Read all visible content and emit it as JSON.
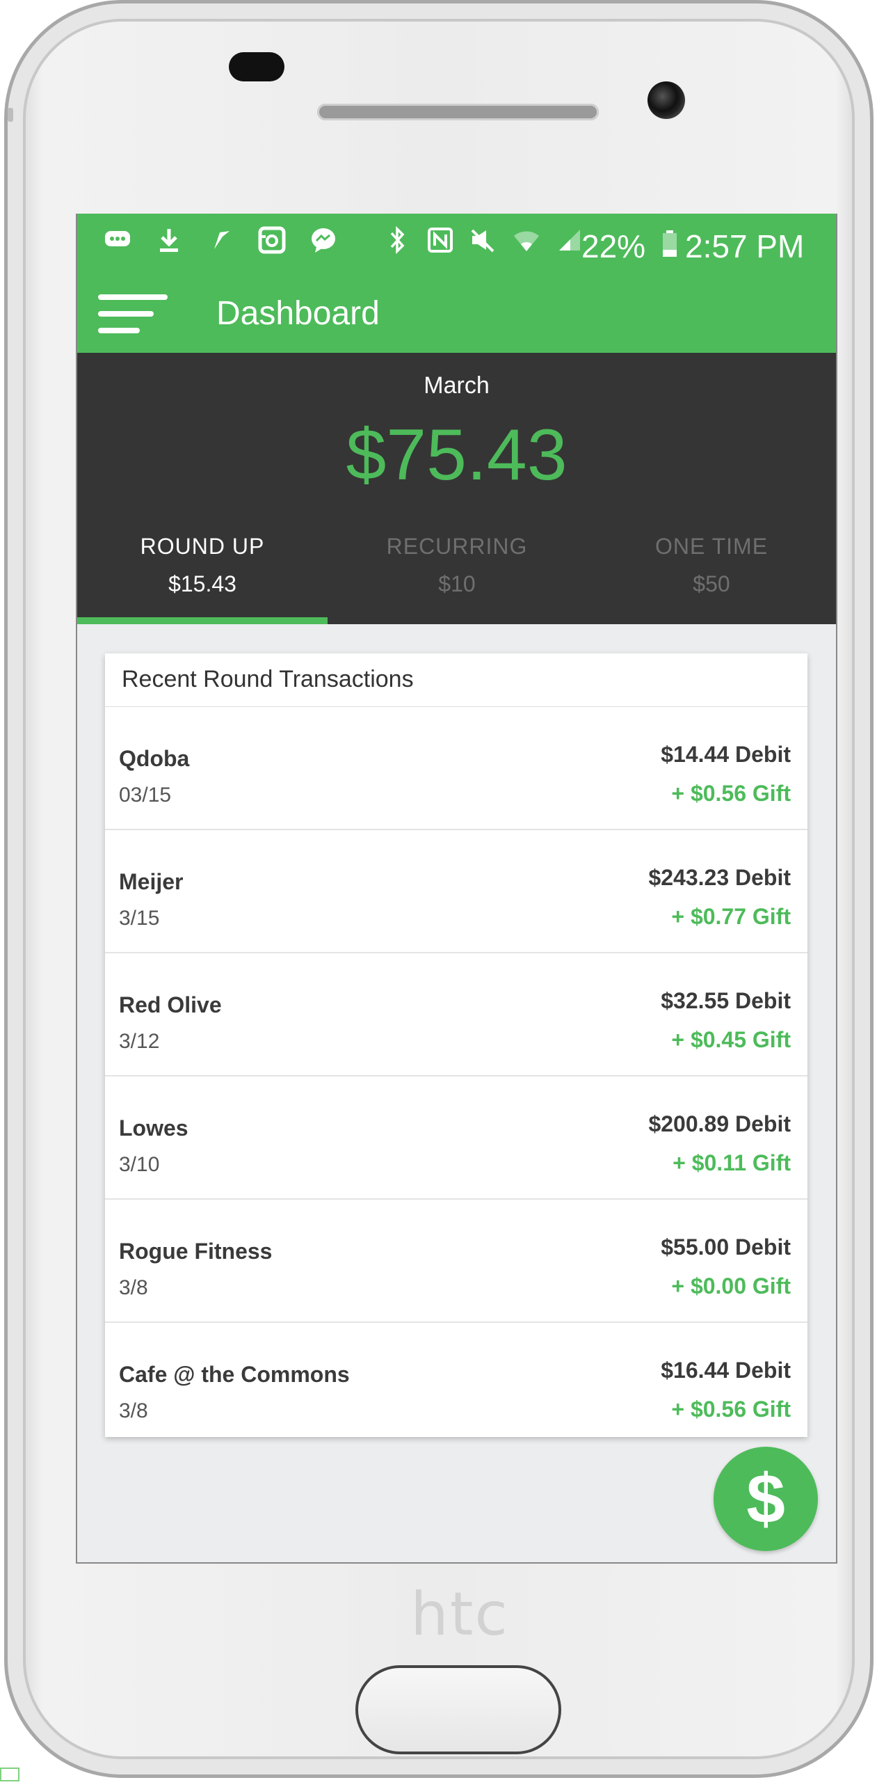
{
  "device": {
    "brand_text": "htc"
  },
  "statusbar": {
    "battery": "22%",
    "time": "2:57 PM",
    "icons_left": [
      "message-icon",
      "download-icon",
      "navigation-icon",
      "instagram-icon",
      "messenger-icon"
    ],
    "icons_right": [
      "bluetooth-icon",
      "nfc-icon",
      "mute-icon",
      "wifi-icon",
      "signal-icon",
      "battery-icon"
    ]
  },
  "appbar": {
    "title": "Dashboard"
  },
  "summary": {
    "month": "March",
    "total": "$75.43",
    "tabs": [
      {
        "label": "ROUND UP",
        "amount": "$15.43",
        "active": true
      },
      {
        "label": "RECURRING",
        "amount": "$10",
        "active": false
      },
      {
        "label": "ONE TIME",
        "amount": "$50",
        "active": false
      }
    ]
  },
  "transactions": {
    "title": "Recent Round Transactions",
    "items": [
      {
        "name": "Qdoba",
        "date": "03/15",
        "debit": "$14.44 Debit",
        "gift": "+ $0.56 Gift"
      },
      {
        "name": "Meijer",
        "date": "3/15",
        "debit": "$243.23 Debit",
        "gift": "+ $0.77 Gift"
      },
      {
        "name": "Red Olive",
        "date": "3/12",
        "debit": "$32.55 Debit",
        "gift": "+ $0.45 Gift"
      },
      {
        "name": "Lowes",
        "date": "3/10",
        "debit": "$200.89 Debit",
        "gift": "+ $0.11 Gift"
      },
      {
        "name": "Rogue Fitness",
        "date": "3/8",
        "debit": "$55.00 Debit",
        "gift": "+ $0.00 Gift"
      },
      {
        "name": "Cafe @ the Commons",
        "date": "3/8",
        "debit": "$16.44 Debit",
        "gift": "+ $0.56 Gift"
      }
    ]
  },
  "fab": {
    "icon": "dollar-icon",
    "symbol": "$"
  },
  "colors": {
    "brand_green": "#4dbb5a",
    "summary_bg": "#353535",
    "screen_bg": "#ecedee"
  }
}
